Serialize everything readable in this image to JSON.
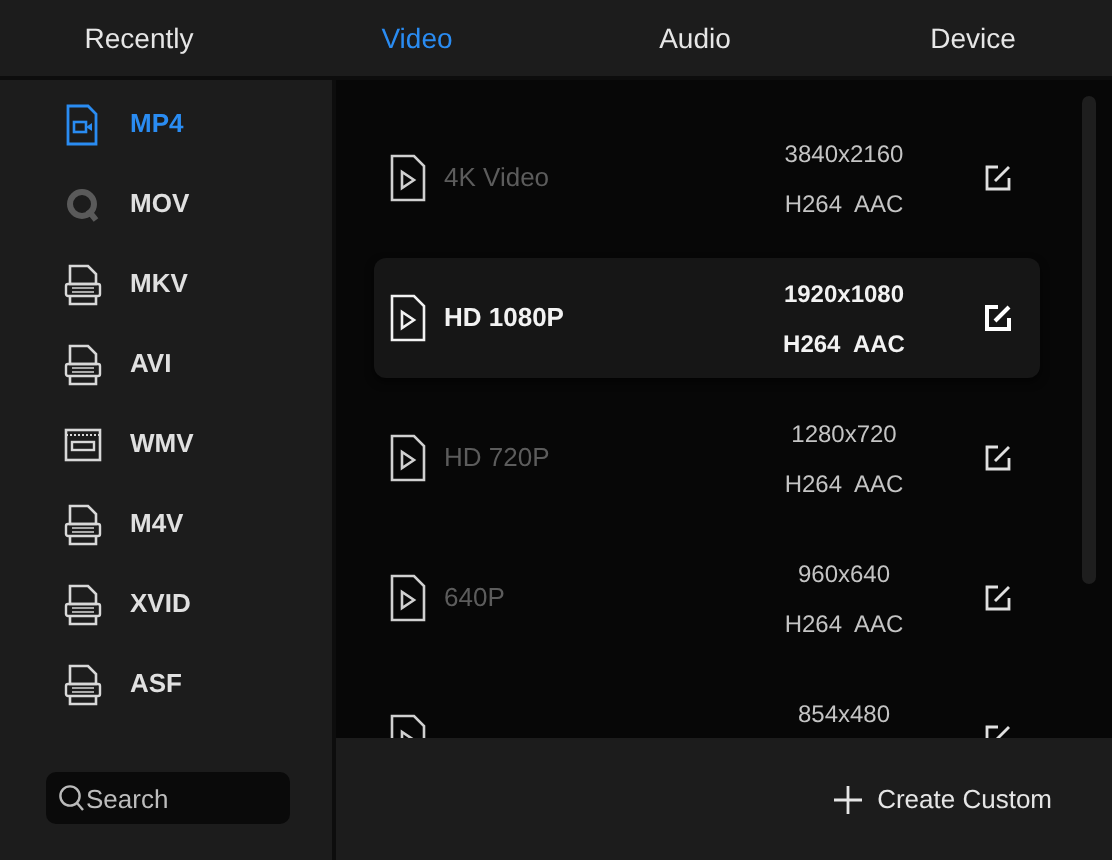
{
  "tabs": [
    {
      "label": "Recently",
      "selected": false
    },
    {
      "label": "Video",
      "selected": true
    },
    {
      "label": "Audio",
      "selected": false
    },
    {
      "label": "Device",
      "selected": false
    }
  ],
  "sidebar": {
    "items": [
      {
        "label": "MP4",
        "kind": "video",
        "selected": true
      },
      {
        "label": "MOV",
        "kind": "quicktime",
        "selected": false
      },
      {
        "label": "MKV",
        "kind": "file",
        "selected": false
      },
      {
        "label": "AVI",
        "kind": "file",
        "selected": false
      },
      {
        "label": "WMV",
        "kind": "window",
        "selected": false
      },
      {
        "label": "M4V",
        "kind": "file",
        "selected": false
      },
      {
        "label": "XVID",
        "kind": "file",
        "selected": false
      },
      {
        "label": "ASF",
        "kind": "file",
        "selected": false
      }
    ],
    "search": {
      "placeholder": "Search"
    }
  },
  "presets": [
    {
      "name": "4K Video",
      "resolution": "3840x2160",
      "codecs": "H264  AAC",
      "selected": false
    },
    {
      "name": "HD 1080P",
      "resolution": "1920x1080",
      "codecs": "H264  AAC",
      "selected": true
    },
    {
      "name": "HD 720P",
      "resolution": "1280x720",
      "codecs": "H264  AAC",
      "selected": false
    },
    {
      "name": "640P",
      "resolution": "960x640",
      "codecs": "H264  AAC",
      "selected": false
    },
    {
      "resolution": "854x480",
      "selected": false
    }
  ],
  "footer": {
    "button": "Create Custom"
  }
}
